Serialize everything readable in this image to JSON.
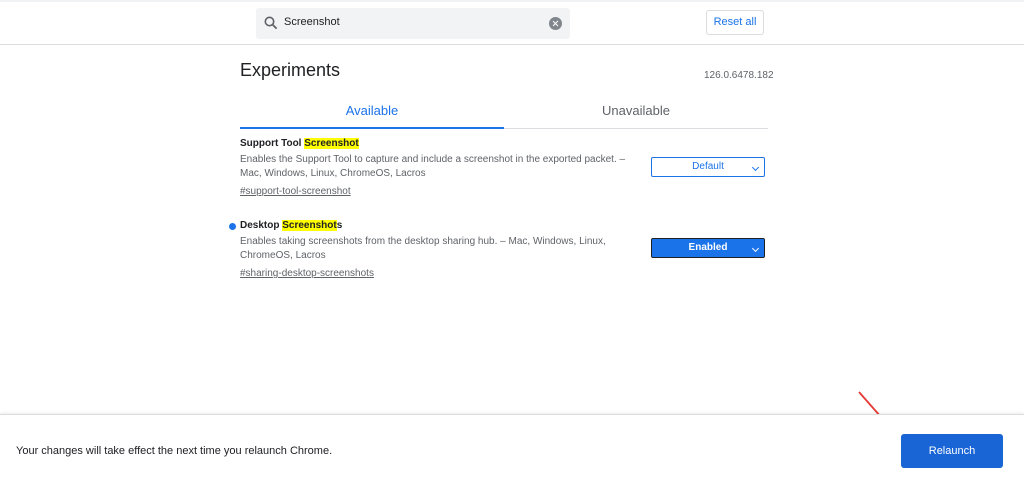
{
  "header": {
    "search_value": "Screenshot",
    "reset_label": "Reset all"
  },
  "page": {
    "title": "Experiments",
    "version": "126.0.6478.182",
    "tabs": [
      {
        "label": "Available",
        "active": true
      },
      {
        "label": "Unavailable",
        "active": false
      }
    ]
  },
  "experiments": [
    {
      "name_prefix": "Support Tool ",
      "name_highlight": "Screenshot",
      "name_suffix": "",
      "description": "Enables the Support Tool to capture and include a screenshot in the exported packet. – Mac, Windows, Linux, ChromeOS, Lacros",
      "link": "#support-tool-screenshot",
      "value": "Default",
      "modified": false
    },
    {
      "name_prefix": "Desktop ",
      "name_highlight": "Screenshot",
      "name_suffix": "s",
      "description": "Enables taking screenshots from the desktop sharing hub. – Mac, Windows, Linux, ChromeOS, Lacros",
      "link": "#sharing-desktop-screenshots",
      "value": "Enabled",
      "modified": true
    }
  ],
  "footer": {
    "message": "Your changes will take effect the next time you relaunch Chrome.",
    "relaunch_label": "Relaunch"
  },
  "colors": {
    "accent": "#1a73e8",
    "highlight": "#ffff00",
    "annotation_arrow": "#e53935"
  }
}
